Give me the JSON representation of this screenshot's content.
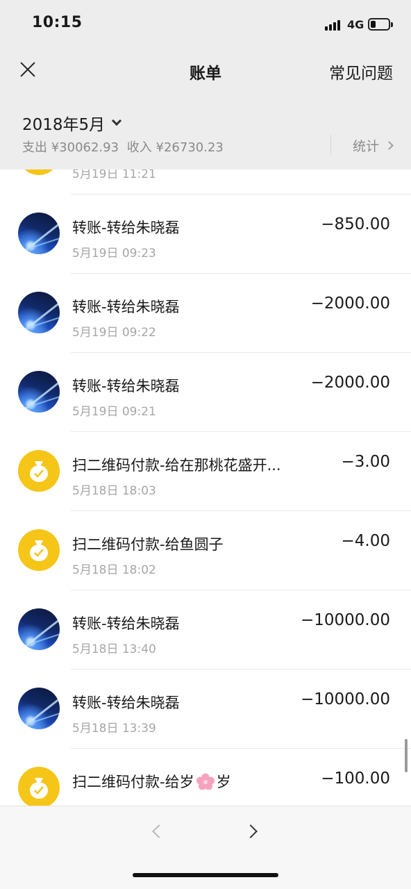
{
  "status_bar": {
    "time": "10:15",
    "network": "4G"
  },
  "nav": {
    "title": "账单",
    "faq_label": "常见问题"
  },
  "month": {
    "label": "2018年5月",
    "summary_expense": "支出 ¥30062.93",
    "summary_income": "收入 ¥26730.23",
    "stats_label": "统计"
  },
  "transactions": [
    {
      "title": "",
      "time": "5月19日 11:21",
      "amount": "",
      "icon": "wallet-icon"
    },
    {
      "title": "转账-转给朱晓磊",
      "time": "5月19日 09:23",
      "amount": "−850.00",
      "icon": "avatar-photo"
    },
    {
      "title": "转账-转给朱晓磊",
      "time": "5月19日 09:22",
      "amount": "−2000.00",
      "icon": "avatar-photo"
    },
    {
      "title": "转账-转给朱晓磊",
      "time": "5月19日 09:21",
      "amount": "−2000.00",
      "icon": "avatar-photo"
    },
    {
      "title": "扫二维码付款-给在那桃花盛开...",
      "time": "5月18日 18:03",
      "amount": "−3.00",
      "icon": "wallet-icon"
    },
    {
      "title": "扫二维码付款-给鱼圆子",
      "time": "5月18日 18:02",
      "amount": "−4.00",
      "icon": "wallet-icon"
    },
    {
      "title": "转账-转给朱晓磊",
      "time": "5月18日 13:40",
      "amount": "−10000.00",
      "icon": "avatar-photo"
    },
    {
      "title": "转账-转给朱晓磊",
      "time": "5月18日 13:39",
      "amount": "−10000.00",
      "icon": "avatar-photo"
    },
    {
      "title_before": "扫二维码付款-给岁",
      "title_after": "岁",
      "time": "",
      "amount": "−100.00",
      "icon": "wallet-icon",
      "title_emoji": "cherry-blossom-icon"
    }
  ],
  "colors": {
    "background": "#ededed",
    "wallet_icon": "#f5c518",
    "muted_text": "#a6a6a6"
  }
}
